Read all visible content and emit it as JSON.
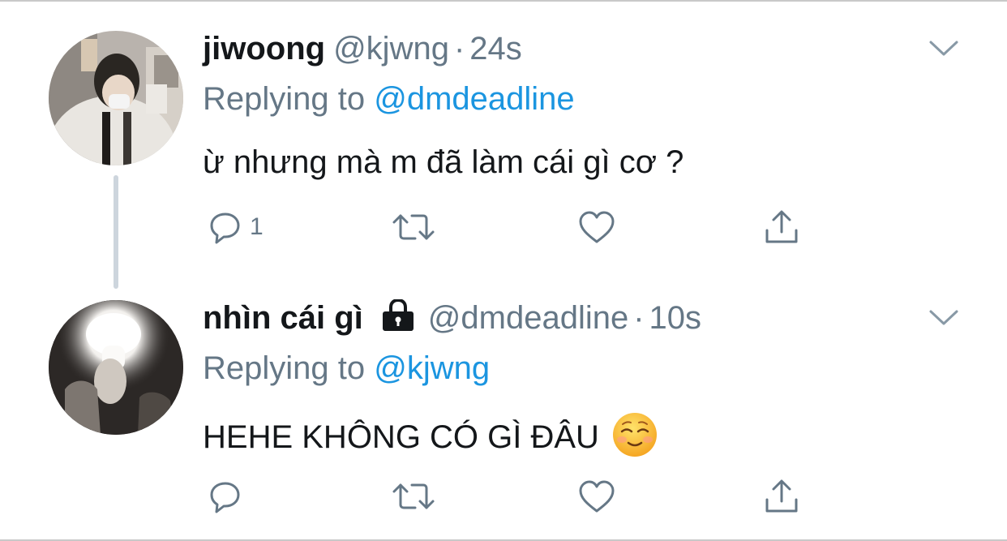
{
  "tweets": [
    {
      "display_name": "jiwoong",
      "handle": "@kjwng",
      "separator": "·",
      "time": "24s",
      "replying_prefix": "Replying to",
      "replying_to": "@dmdeadline",
      "text": "ừ nhưng mà m đã làm cái gì cơ ?",
      "reply_count": "1",
      "locked": false
    },
    {
      "display_name": "nhìn cái gì",
      "handle": "@dmdeadline",
      "separator": "·",
      "time": "10s",
      "replying_prefix": "Replying to",
      "replying_to": "@kjwng",
      "text": "HEHE KHÔNG CÓ GÌ ĐÂU",
      "reply_count": "",
      "locked": true
    }
  ],
  "icons": {
    "reply": "reply-icon",
    "retweet": "retweet-icon",
    "like": "heart-icon",
    "share": "share-icon",
    "more": "chevron-down-icon",
    "lock": "lock-icon",
    "emoji": "smiling-face-emoji"
  },
  "colors": {
    "text": "#14171a",
    "secondary": "#657786",
    "link": "#1b95e0",
    "thread_line": "#cdd5dd"
  }
}
